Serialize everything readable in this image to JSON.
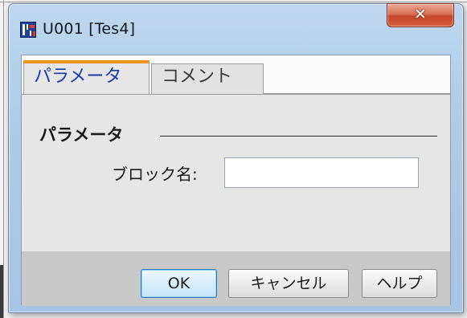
{
  "window": {
    "title": "U001 [Tes4]",
    "close_glyph": "✕",
    "icon": "block-app-icon"
  },
  "tabs": [
    {
      "label": "パラメータ",
      "selected": true
    },
    {
      "label": "コメント",
      "selected": false
    }
  ],
  "panel": {
    "section_title": "パラメータ",
    "block_name_label": "ブロック名:",
    "block_name_value": ""
  },
  "buttons": {
    "ok": "OK",
    "cancel": "キャンセル",
    "help": "ヘルプ"
  },
  "colors": {
    "active_tab_accent": "#f09418",
    "active_tab_text": "#1a3aa8",
    "close_button": "#c6452a",
    "default_button_border": "#2f78b9"
  }
}
